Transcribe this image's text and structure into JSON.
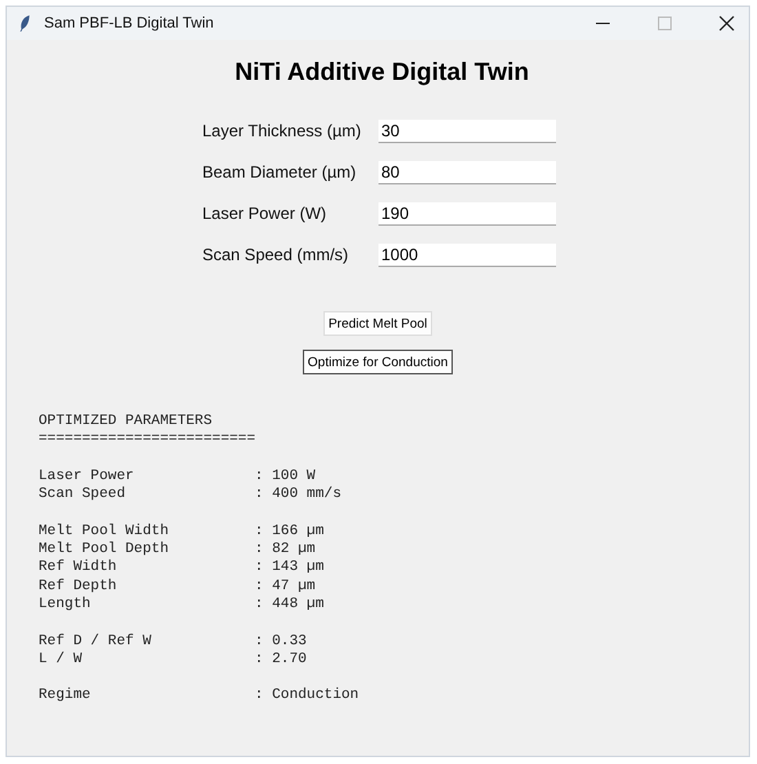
{
  "window": {
    "title": "Sam PBF-LB Digital Twin"
  },
  "heading": "NiTi Additive Digital Twin",
  "fields": [
    {
      "label": "Layer Thickness (µm)",
      "value": "30"
    },
    {
      "label": "Beam Diameter (µm)",
      "value": "80"
    },
    {
      "label": "Laser Power (W)",
      "value": "190"
    },
    {
      "label": "Scan Speed (mm/s)",
      "value": "1000"
    }
  ],
  "buttons": [
    {
      "label": "Predict Melt Pool",
      "focused": false
    },
    {
      "label": "Optimize for Conduction",
      "focused": true
    }
  ],
  "output": {
    "title": "OPTIMIZED PARAMETERS",
    "rule": "=========================",
    "groups": [
      [
        {
          "label": "Laser Power",
          "value": ": 100 W"
        },
        {
          "label": "Scan Speed",
          "value": ": 400 mm/s"
        }
      ],
      [
        {
          "label": "Melt Pool Width",
          "value": ": 166 µm"
        },
        {
          "label": "Melt Pool Depth",
          "value": ": 82 µm"
        },
        {
          "label": "Ref Width",
          "value": ": 143 µm"
        },
        {
          "label": "Ref Depth",
          "value": ": 47 µm"
        },
        {
          "label": "Length",
          "value": ": 448 µm"
        }
      ],
      [
        {
          "label": "Ref D / Ref W",
          "value": ": 0.33"
        },
        {
          "label": "L / W",
          "value": ": 2.70"
        }
      ],
      [
        {
          "label": "Regime",
          "value": ": Conduction"
        }
      ]
    ]
  }
}
